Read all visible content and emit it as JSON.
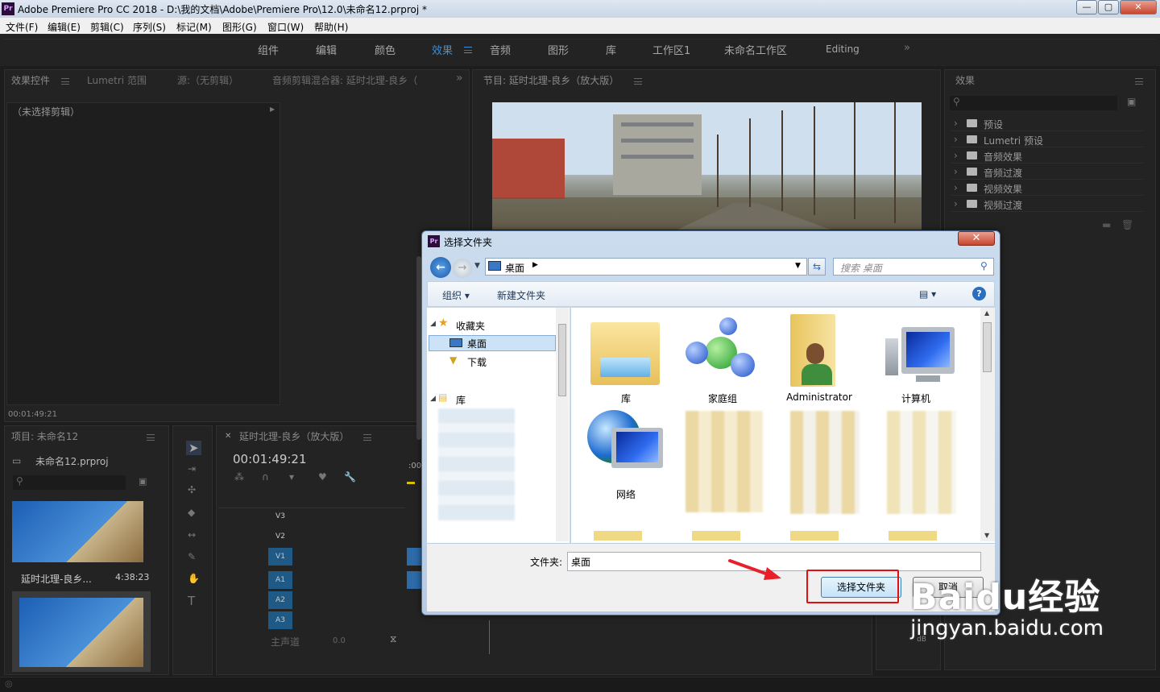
{
  "window": {
    "title": "Adobe Premiere Pro CC 2018 - D:\\我的文档\\Adobe\\Premiere Pro\\12.0\\未命名12.prproj *",
    "app_icon": "Pr",
    "controls": [
      "—",
      "▢",
      "✕"
    ]
  },
  "menu": [
    "文件(F)",
    "编辑(E)",
    "剪辑(C)",
    "序列(S)",
    "标记(M)",
    "图形(G)",
    "窗口(W)",
    "帮助(H)"
  ],
  "workspaces": [
    "组件",
    "编辑",
    "颜色",
    "效果",
    "音频",
    "图形",
    "库",
    "工作区1",
    "未命名工作区",
    "Editing"
  ],
  "workspace_more": "»",
  "source_panel": {
    "tabs": [
      "效果控件",
      "Lumetri 范围",
      "源:（无剪辑）",
      "音频剪辑混合器: 延时北理-良乡（"
    ],
    "no_clip": "（未选择剪辑）",
    "more": "»",
    "timecode": "00:01:49:21"
  },
  "program_panel": {
    "title": "节目: 延时北理-良乡（放大版）"
  },
  "effects_panel": {
    "title": "效果",
    "items": [
      "预设",
      "Lumetri 预设",
      "音频效果",
      "音频过渡",
      "视频效果",
      "视频过渡"
    ]
  },
  "project_panel": {
    "title": "项目: 未命名12",
    "file": "未命名12.prproj",
    "clips": [
      {
        "name": "延时北理-良乡...",
        "duration": "4:38:23"
      }
    ]
  },
  "timeline": {
    "tab": "延时北理-良乡（放大版）",
    "timecode": "00:01:49:21",
    "tracks": [
      "V3",
      "V2",
      "V1",
      "A1",
      "A2",
      "A3"
    ],
    "master": "主声道",
    "master_value": "0.0",
    "ruler_start": ":00"
  },
  "dialog": {
    "title": "选择文件夹",
    "address": "桌面",
    "search_placeholder": "搜索 桌面",
    "organize": "组织 ▾",
    "new_folder": "新建文件夹",
    "nav": {
      "favorites": "收藏夹",
      "desktop": "桌面",
      "downloads": "下载",
      "libraries": "库"
    },
    "icons": [
      "库",
      "家庭组",
      "Administrator",
      "计算机",
      "网络"
    ],
    "folder_label": "文件夹:",
    "folder_value": "桌面",
    "select_button": "选择文件夹",
    "cancel_button": "取消"
  },
  "watermark": {
    "brand": "Baidu经验",
    "url": "jingyan.baidu.com"
  },
  "colors": {
    "accent_blue": "#1f5a86",
    "highlight_red": "#e01010",
    "arrow_red": "#e8202a"
  }
}
